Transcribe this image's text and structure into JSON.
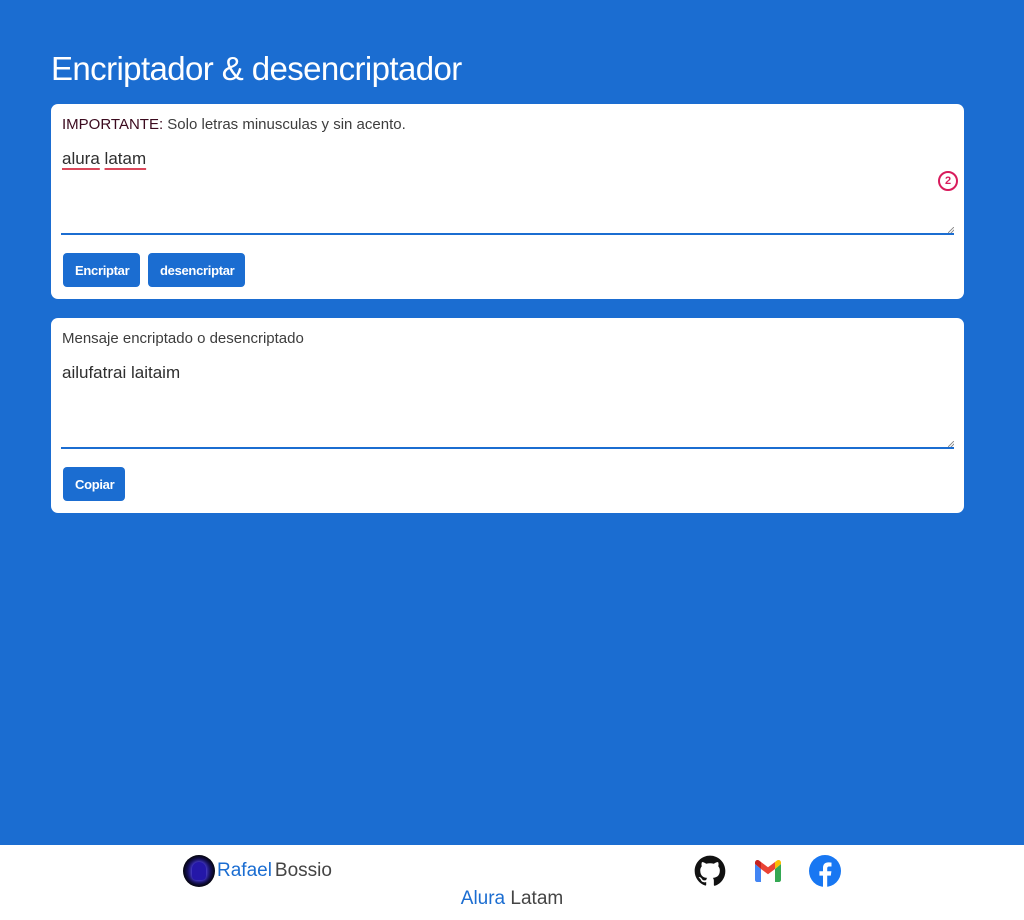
{
  "page": {
    "title": "Encriptador & desencriptador"
  },
  "input_card": {
    "label_strong": "IMPORTANTE:",
    "label_rest": " Solo letras minusculas y sin acento.",
    "text_word1": "alura",
    "text_word2": "latam",
    "grammar_count": "2",
    "encrypt_label": "Encriptar",
    "decrypt_label": "desencriptar"
  },
  "output_card": {
    "label": "Mensaje encriptado o desencriptado",
    "text": "ailufatrai laitaim",
    "copy_label": "Copiar"
  },
  "footer": {
    "author_first": "Rafael",
    "author_last": "Bossio",
    "brand_first": "Alura",
    "brand_second": "Latam",
    "social_icons": [
      "github-icon",
      "gmail-icon",
      "facebook-icon"
    ]
  },
  "colors": {
    "accent": "#1b6dd1",
    "background": "#1b6dd1",
    "card": "#ffffff",
    "spellcheck": "#d9475a",
    "grammar_badge": "#d81b5c"
  }
}
